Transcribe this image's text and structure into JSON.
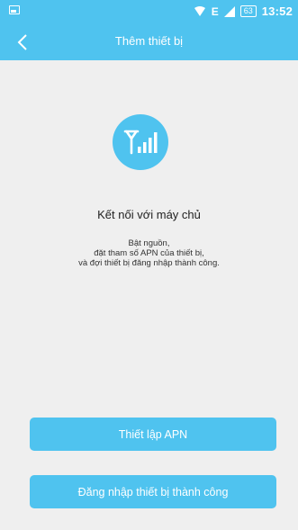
{
  "status_bar": {
    "network": "E",
    "battery": "63",
    "time": "13:52",
    "icons": [
      "image-icon",
      "wifi-icon",
      "signal-icon",
      "battery-icon"
    ]
  },
  "toolbar": {
    "title": "Thêm thiết bị",
    "back_icon": "chevron-left-icon"
  },
  "main": {
    "icon": "signal-antenna-icon",
    "heading": "Kết nối với máy chủ",
    "instructions": [
      "Bật nguồn,",
      "đặt tham số APN của thiết bị,",
      "và đợi thiết bị đăng nhập thành công."
    ]
  },
  "buttons": {
    "apn_label": "Thiết lập APN",
    "login_label": "Đăng nhập thiết bị thành công"
  },
  "colors": {
    "accent": "#4fc3ef",
    "background": "#efefef"
  }
}
